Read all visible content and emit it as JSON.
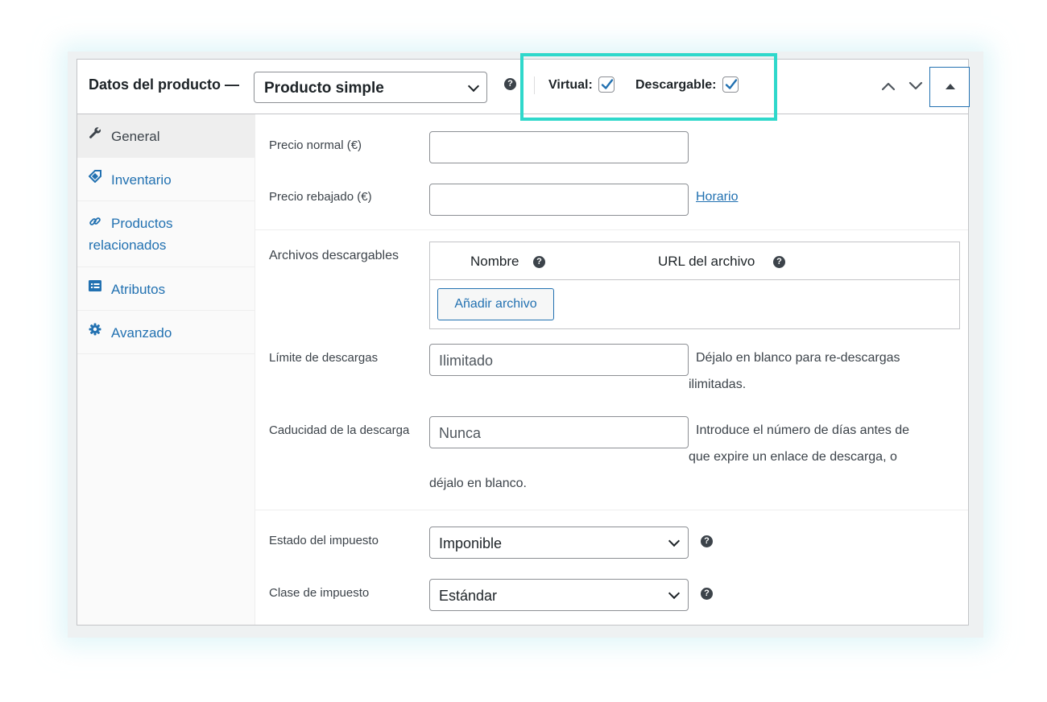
{
  "header": {
    "title": "Datos del producto —",
    "product_type": "Producto simple",
    "virtual_label": "Virtual:",
    "virtual_checked": true,
    "downloadable_label": "Descargable:",
    "downloadable_checked": true
  },
  "sidebar": {
    "items": [
      {
        "label": "General",
        "icon": "wrench-icon",
        "active": true
      },
      {
        "label": "Inventario",
        "icon": "tag-icon",
        "active": false
      },
      {
        "label": "Productos",
        "label2": "relacionados",
        "icon": "link-icon",
        "active": false
      },
      {
        "label": "Atributos",
        "icon": "list-icon",
        "active": false
      },
      {
        "label": "Avanzado",
        "icon": "gear-icon",
        "active": false
      }
    ]
  },
  "general": {
    "regular_price_label": "Precio normal (€)",
    "regular_price_value": "",
    "sale_price_label": "Precio rebajado (€)",
    "sale_price_value": "",
    "schedule_link": "Horario",
    "downloadable_files_label": "Archivos descargables",
    "files_col_name": "Nombre",
    "files_col_url": "URL del archivo",
    "add_file_button": "Añadir archivo",
    "download_limit_label": "Límite de descargas",
    "download_limit_placeholder": "Ilimitado",
    "download_limit_desc1": "Déjalo en blanco para re-descargas",
    "download_limit_desc2": "ilimitadas.",
    "download_expiry_label": "Caducidad de la descarga",
    "download_expiry_placeholder": "Nunca",
    "download_expiry_desc1": "Introduce el número de días antes de",
    "download_expiry_desc2": "que expire un enlace de descarga, o",
    "download_expiry_desc3": "déjalo en blanco.",
    "tax_status_label": "Estado del impuesto",
    "tax_status_value": "Imponible",
    "tax_class_label": "Clase de impuesto",
    "tax_class_value": "Estándar"
  },
  "colors": {
    "accent": "#2271b1",
    "highlight": "#2fd8cb",
    "border": "#c3c4c7"
  }
}
